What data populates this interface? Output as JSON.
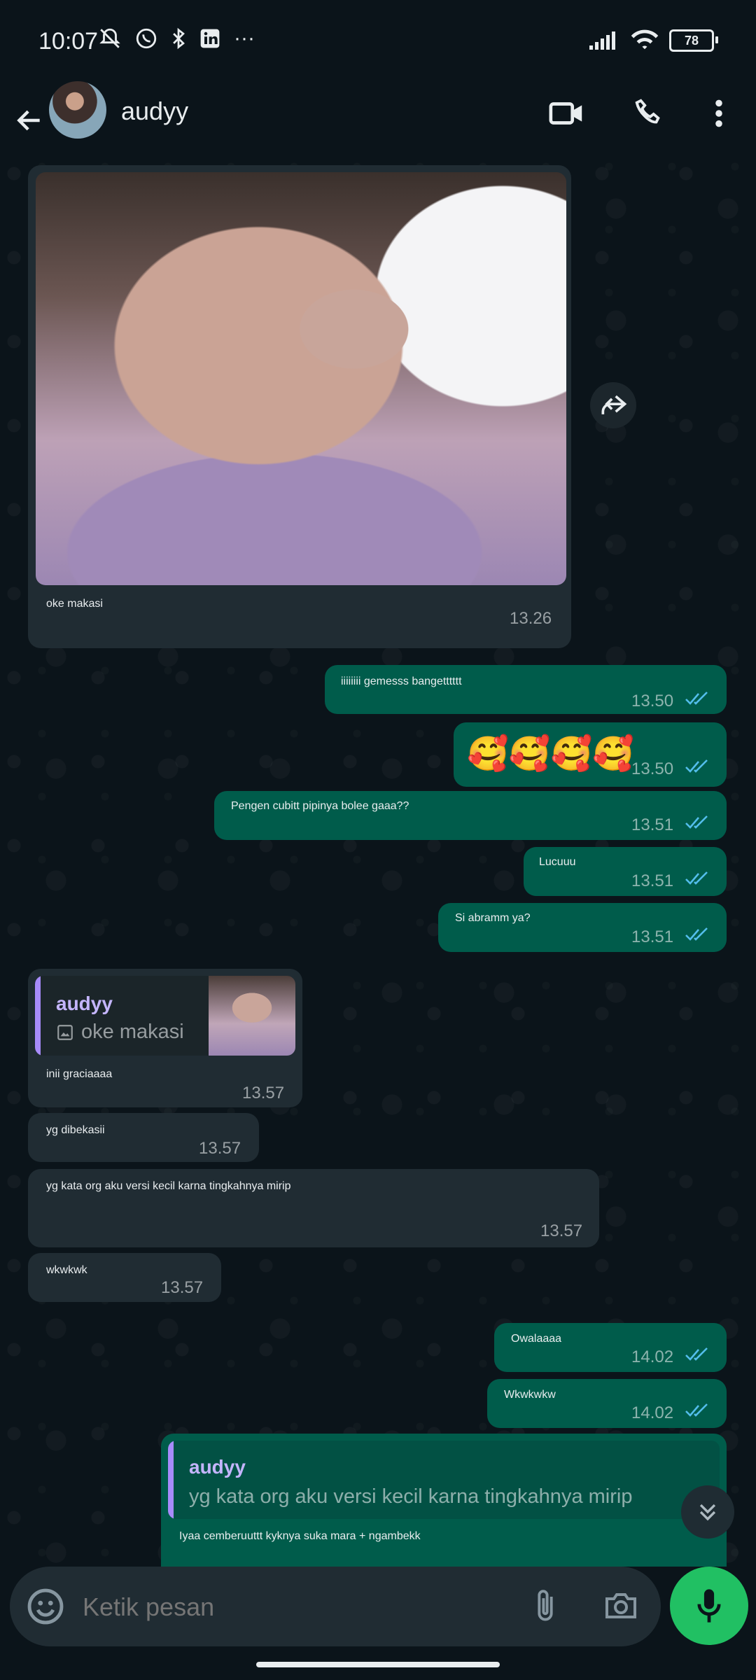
{
  "status_bar": {
    "time": "10:07",
    "more_indicator": "···",
    "battery": "78"
  },
  "header": {
    "contact_name": "audyy",
    "back_icon": "arrow-left-icon",
    "video_call_icon": "video-camera-icon",
    "voice_call_icon": "phone-icon",
    "menu_icon": "more-vertical-icon"
  },
  "messages": [
    {
      "dir": "in",
      "type": "image",
      "caption": "oke makasi",
      "time": "13.26"
    },
    {
      "dir": "out",
      "text": "iiiiiiii gemesss bangetttttt",
      "time": "13.50",
      "read": true
    },
    {
      "dir": "out",
      "text": "🥰🥰🥰🥰",
      "time": "13.50",
      "read": true
    },
    {
      "dir": "out",
      "text": "Pengen cubitt pipinya bolee gaaa??",
      "time": "13.51",
      "read": true
    },
    {
      "dir": "out",
      "text": "Lucuuu",
      "time": "13.51",
      "read": true
    },
    {
      "dir": "out",
      "text": "Si abramm ya?",
      "time": "13.51",
      "read": true
    },
    {
      "dir": "in",
      "text": "inii graciaaaa",
      "time": "13.57",
      "reply": {
        "name": "audyy",
        "text": "oke makasi",
        "has_image": true
      }
    },
    {
      "dir": "in",
      "text": "yg dibekasii",
      "time": "13.57"
    },
    {
      "dir": "in",
      "text": "yg kata org aku versi kecil karna tingkahnya mirip",
      "time": "13.57"
    },
    {
      "dir": "in",
      "text": "wkwkwk",
      "time": "13.57"
    },
    {
      "dir": "out",
      "text": "Owalaaaa",
      "time": "14.02",
      "read": true
    },
    {
      "dir": "out",
      "text": "Wkwkwkw",
      "time": "14.02",
      "read": true
    },
    {
      "dir": "out",
      "text": "Iyaa cemberuuttt kyknya suka mara + ngambekk",
      "reply": {
        "name": "audyy",
        "text": "yg kata org aku versi kecil karna tingkahnya mirip"
      }
    }
  ],
  "composer": {
    "placeholder": "Ketik pesan"
  },
  "colors": {
    "incoming": "#202c33",
    "outgoing": "#005c4b",
    "accent_green": "#21c063",
    "read_ticks": "#53bdeb",
    "quote_bar": "#a78bfa"
  }
}
